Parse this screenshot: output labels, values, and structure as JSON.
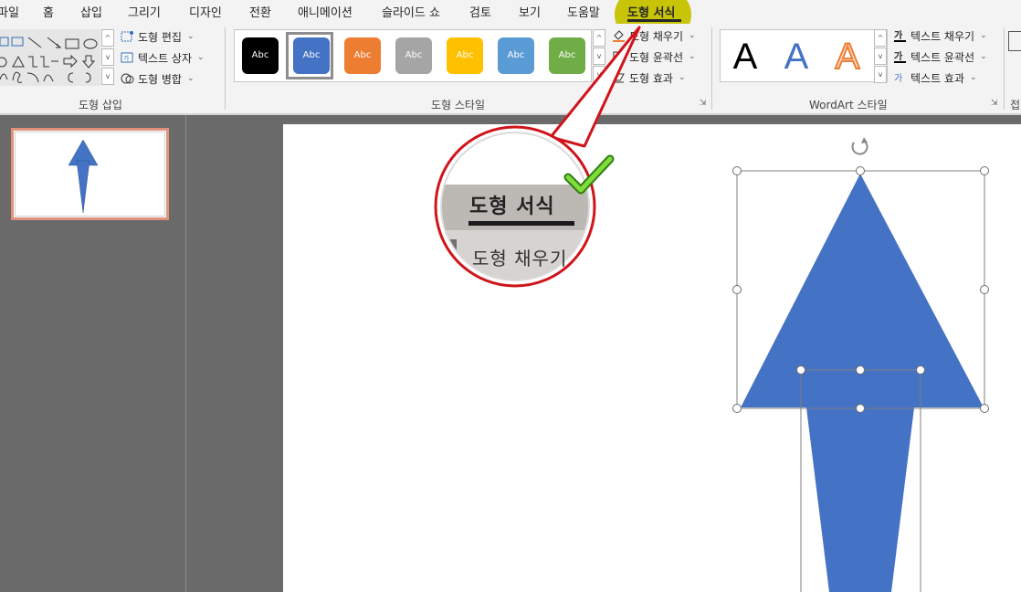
{
  "colors": {
    "accent_highlight": "#c8c40a",
    "shape_fill": "#4472c4",
    "callout_red": "#d0141b",
    "check_green": "#5cc42a",
    "thumb_border": "#e0927c"
  },
  "tabs": [
    {
      "label": "파일"
    },
    {
      "label": "홈"
    },
    {
      "label": "삽입"
    },
    {
      "label": "그리기"
    },
    {
      "label": "디자인"
    },
    {
      "label": "전환"
    },
    {
      "label": "애니메이션"
    },
    {
      "label": "슬라이드 쇼"
    },
    {
      "label": "검토"
    },
    {
      "label": "보기"
    },
    {
      "label": "도움말"
    },
    {
      "label": "도형 서식",
      "active": true
    }
  ],
  "groups": {
    "insert_shapes": {
      "label": "도형 삽입",
      "edit_shape": "도형 편집",
      "text_box": "텍스트 상자",
      "merge_shapes": "도형 병합"
    },
    "shape_styles": {
      "label": "도형 스타일",
      "swatches": [
        {
          "text": "Abc",
          "color": "#000000"
        },
        {
          "text": "Abc",
          "color": "#4472c4",
          "selected": true
        },
        {
          "text": "Abc",
          "color": "#ed7d31"
        },
        {
          "text": "Abc",
          "color": "#a5a5a5"
        },
        {
          "text": "Abc",
          "color": "#ffc000"
        },
        {
          "text": "Abc",
          "color": "#5b9bd5"
        },
        {
          "text": "Abc",
          "color": "#70ad47"
        }
      ],
      "shape_fill": "도형 채우기",
      "shape_outline": "도형 윤곽선",
      "shape_effects": "도형 효과"
    },
    "wordart_styles": {
      "label": "WordArt 스타일",
      "samples": [
        "A",
        "A",
        "A"
      ],
      "text_fill": "텍스트 채우기",
      "text_outline": "텍스트 윤곽선",
      "text_effects": "텍스트 효과",
      "text_fill_icon_char": "가"
    },
    "next_group_label": "접"
  },
  "magnifier": {
    "title": "도형 서식",
    "subtitle": "도형 채우기"
  }
}
